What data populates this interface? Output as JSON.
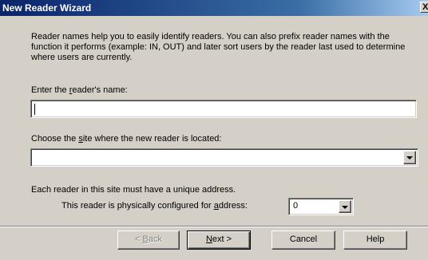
{
  "window": {
    "title": "New Reader Wizard",
    "close_glyph": "X"
  },
  "intro_text": "Reader names help you to easily identify readers. You can also prefix reader names with the function it performs (example: IN, OUT) and later sort users by the reader last used to determine where users are currently.",
  "name_field": {
    "label_pre": "Enter the ",
    "label_accel": "r",
    "label_post": "eader's name:",
    "value": ""
  },
  "site_field": {
    "label_pre": "Choose the ",
    "label_accel": "s",
    "label_post": "ite where the new reader is located:",
    "value": ""
  },
  "address": {
    "note": "Each reader in this site must have a unique address.",
    "label_pre": "This reader is physically configured for ",
    "label_accel": "a",
    "label_post": "ddress:",
    "value": "0"
  },
  "buttons": {
    "back": {
      "accel": "B",
      "rest": "ack",
      "prefix": "< "
    },
    "next": {
      "accel": "N",
      "rest": "ext >"
    },
    "cancel": "Cancel",
    "help": "Help"
  }
}
